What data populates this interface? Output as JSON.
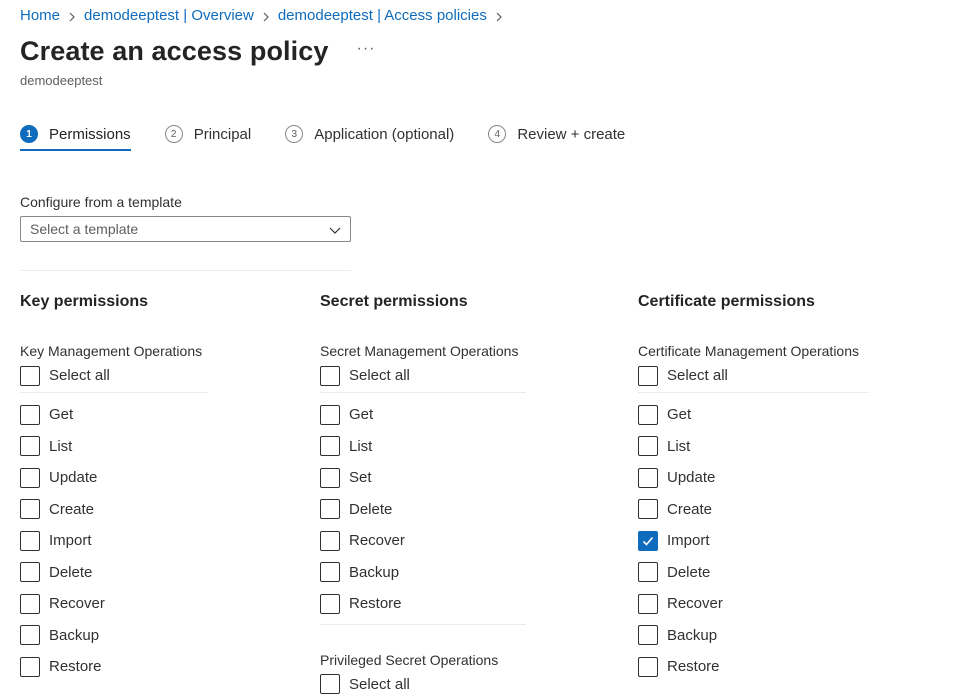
{
  "breadcrumb": [
    {
      "label": "Home"
    },
    {
      "label": "demodeeptest | Overview"
    },
    {
      "label": "demodeeptest | Access policies"
    }
  ],
  "header": {
    "title": "Create an access policy",
    "more_label": "···",
    "subtitle": "demodeeptest"
  },
  "tabs": [
    {
      "step": "1",
      "label": "Permissions",
      "active": true
    },
    {
      "step": "2",
      "label": "Principal",
      "active": false
    },
    {
      "step": "3",
      "label": "Application (optional)",
      "active": false
    },
    {
      "step": "4",
      "label": "Review + create",
      "active": false
    }
  ],
  "template": {
    "label": "Configure from a template",
    "placeholder": "Select a template"
  },
  "key_permissions": {
    "title": "Key permissions",
    "group": "Key Management Operations",
    "select_all": "Select all",
    "items": [
      {
        "label": "Get",
        "checked": false
      },
      {
        "label": "List",
        "checked": false
      },
      {
        "label": "Update",
        "checked": false
      },
      {
        "label": "Create",
        "checked": false
      },
      {
        "label": "Import",
        "checked": false
      },
      {
        "label": "Delete",
        "checked": false
      },
      {
        "label": "Recover",
        "checked": false
      },
      {
        "label": "Backup",
        "checked": false
      },
      {
        "label": "Restore",
        "checked": false
      }
    ]
  },
  "secret_permissions": {
    "title": "Secret permissions",
    "group": "Secret Management Operations",
    "select_all": "Select all",
    "items": [
      {
        "label": "Get",
        "checked": false
      },
      {
        "label": "List",
        "checked": false
      },
      {
        "label": "Set",
        "checked": false
      },
      {
        "label": "Delete",
        "checked": false
      },
      {
        "label": "Recover",
        "checked": false
      },
      {
        "label": "Backup",
        "checked": false
      },
      {
        "label": "Restore",
        "checked": false
      }
    ],
    "group2": "Privileged Secret Operations",
    "select_all2": "Select all"
  },
  "certificate_permissions": {
    "title": "Certificate permissions",
    "group": "Certificate Management Operations",
    "select_all": "Select all",
    "items": [
      {
        "label": "Get",
        "checked": false
      },
      {
        "label": "List",
        "checked": false
      },
      {
        "label": "Update",
        "checked": false
      },
      {
        "label": "Create",
        "checked": false
      },
      {
        "label": "Import",
        "checked": true
      },
      {
        "label": "Delete",
        "checked": false
      },
      {
        "label": "Recover",
        "checked": false
      },
      {
        "label": "Backup",
        "checked": false
      },
      {
        "label": "Restore",
        "checked": false
      }
    ]
  },
  "colors": {
    "accent": "#0f6cbd",
    "text": "#323130",
    "divider": "#edebe9"
  },
  "icons": {
    "breadcrumb_separator": "chevron-right-icon",
    "dropdown": "chevron-down-icon",
    "checkmark": "checkmark-icon",
    "more": "more-horizontal-icon"
  }
}
